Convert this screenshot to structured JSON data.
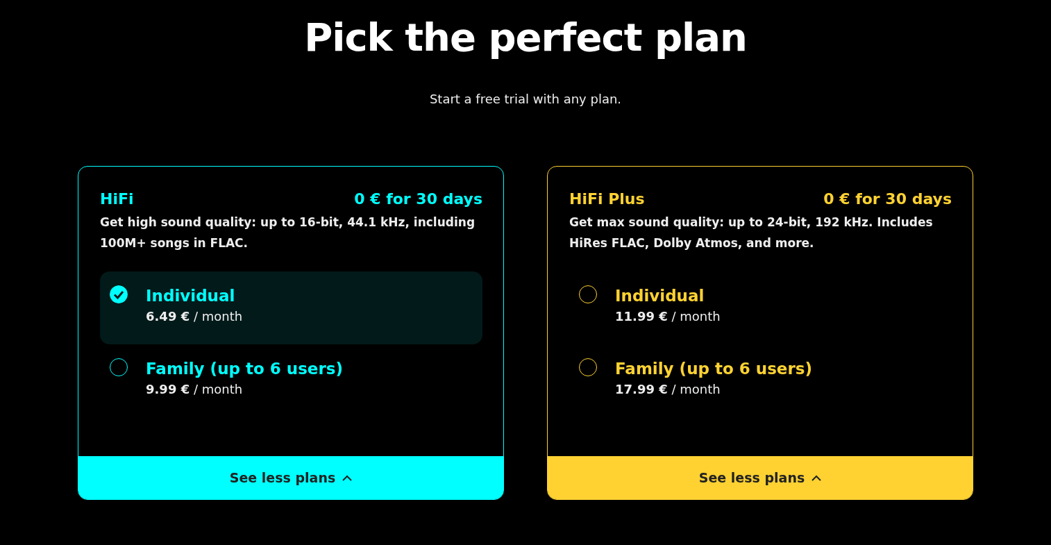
{
  "heading": "Pick the perfect plan",
  "subheading": "Start a free trial with any plan.",
  "plans": [
    {
      "name": "HiFi",
      "trial": "0 € for 30 days",
      "description": "Get high sound quality: up to 16-bit, 44.1 kHz, including 100M+ songs in FLAC.",
      "color": "#00ffff",
      "options": [
        {
          "name": "Individual",
          "price": "**6.49 €** / month",
          "selected": true
        },
        {
          "name": "Family (up to 6 users)",
          "price": "**9.99 €** / month",
          "selected": false
        }
      ],
      "toggle": {
        "label": "See less plans",
        "expanded": true
      }
    },
    {
      "name": "HiFi Plus",
      "trial": "0 € for 30 days",
      "description": "Get max sound quality: up to 24-bit, 192 kHz. Includes HiRes FLAC, Dolby Atmos, and more.",
      "color": "#ffd232",
      "options": [
        {
          "name": "Individual",
          "price": "**11.99 €** / month",
          "selected": false
        },
        {
          "name": "Family (up to 6 users)",
          "price": "**17.99 €** / month",
          "selected": false
        }
      ],
      "toggle": {
        "label": "See less plans",
        "expanded": true
      }
    }
  ]
}
